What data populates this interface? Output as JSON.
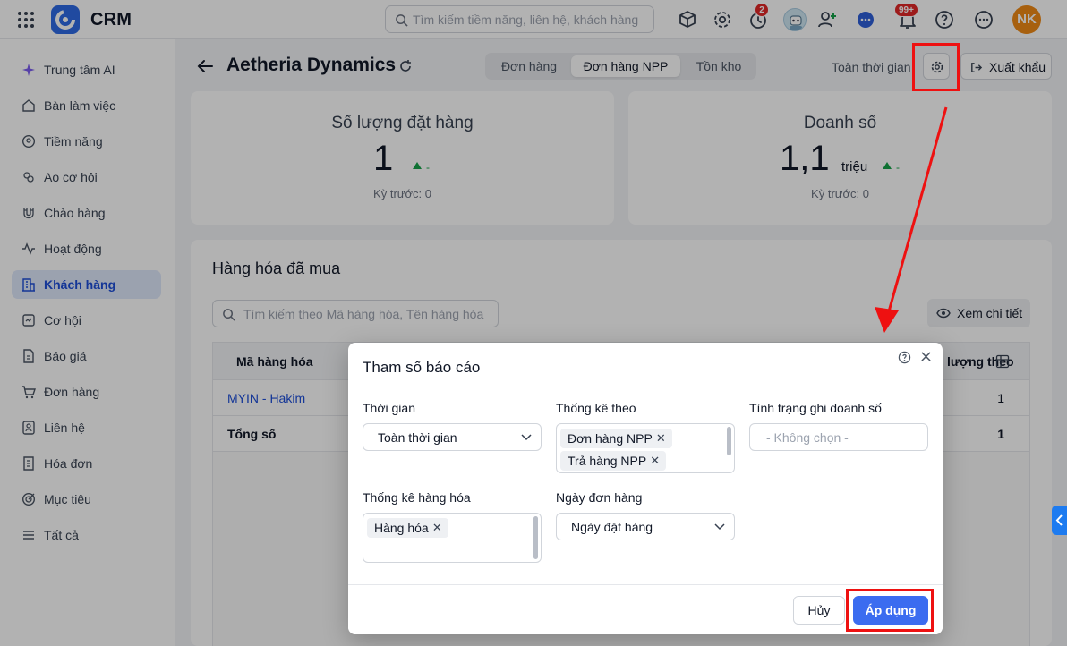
{
  "app": {
    "name": "CRM"
  },
  "topbar": {
    "search_placeholder": "Tìm kiếm tiềm năng, liên hệ, khách hàng",
    "timer_badge": "2",
    "bell_badge": "99+",
    "user_initials": "NK"
  },
  "sidebar": {
    "items": [
      {
        "label": "Trung tâm AI",
        "icon": "ai-sparkle-icon"
      },
      {
        "label": "Bàn làm việc",
        "icon": "home-icon"
      },
      {
        "label": "Tiềm năng",
        "icon": "leads-icon"
      },
      {
        "label": "Ao cơ hội",
        "icon": "pool-icon"
      },
      {
        "label": "Chào hàng",
        "icon": "magnet-icon"
      },
      {
        "label": "Hoạt động",
        "icon": "activity-icon"
      },
      {
        "label": "Khách hàng",
        "icon": "building-icon",
        "active": true
      },
      {
        "label": "Cơ hội",
        "icon": "opportunity-icon"
      },
      {
        "label": "Báo giá",
        "icon": "quote-icon"
      },
      {
        "label": "Đơn hàng",
        "icon": "cart-icon"
      },
      {
        "label": "Liên hệ",
        "icon": "contact-icon"
      },
      {
        "label": "Hóa đơn",
        "icon": "invoice-icon"
      },
      {
        "label": "Mục tiêu",
        "icon": "target-icon"
      },
      {
        "label": "Tất cả",
        "icon": "menu-icon"
      }
    ]
  },
  "header": {
    "title": "Aetheria Dynamics",
    "tabs": [
      "Đơn hàng",
      "Đơn hàng NPP",
      "Tồn kho"
    ],
    "active_tab": "Đơn hàng NPP",
    "time_filter": "Toàn thời gian",
    "export_label": "Xuất khẩu"
  },
  "kpis": [
    {
      "title": "Số lượng đặt hàng",
      "value": "1",
      "unit": "",
      "trend": "-",
      "previous": "Kỳ trước: 0"
    },
    {
      "title": "Doanh số",
      "value": "1,1",
      "unit": "triệu",
      "trend": "-",
      "previous": "Kỳ trước: 0"
    }
  ],
  "goods": {
    "title": "Hàng hóa đã mua",
    "search_placeholder": "Tìm kiếm theo Mã hàng hóa, Tên hàng hóa",
    "view_detail_label": "Xem chi tiết",
    "columns": [
      "Mã hàng hóa",
      "lượng theo"
    ],
    "rows": [
      {
        "code": "MYIN - Hakim",
        "qty": "1"
      }
    ],
    "total_label": "Tổng số",
    "total_qty": "1"
  },
  "dialog": {
    "title": "Tham số báo cáo",
    "time_label": "Thời gian",
    "time_value": "Toàn thời gian",
    "stat_by_label": "Thống kê theo",
    "stat_by_chips": [
      "Đơn hàng NPP",
      "Trả hàng NPP"
    ],
    "revenue_status_label": "Tình trạng ghi doanh số",
    "revenue_status_placeholder": "- Không chọn -",
    "goods_stat_label": "Thống kê hàng hóa",
    "goods_stat_chips": [
      "Hàng hóa"
    ],
    "order_date_label": "Ngày đơn hàng",
    "order_date_value": "Ngày đặt hàng",
    "cancel_label": "Hủy",
    "apply_label": "Áp dụng"
  },
  "colors": {
    "accent": "#3b6cf0",
    "annotation": "#ee1111",
    "active_nav_bg": "#dfe8fb",
    "trend_up": "#16a34a"
  }
}
